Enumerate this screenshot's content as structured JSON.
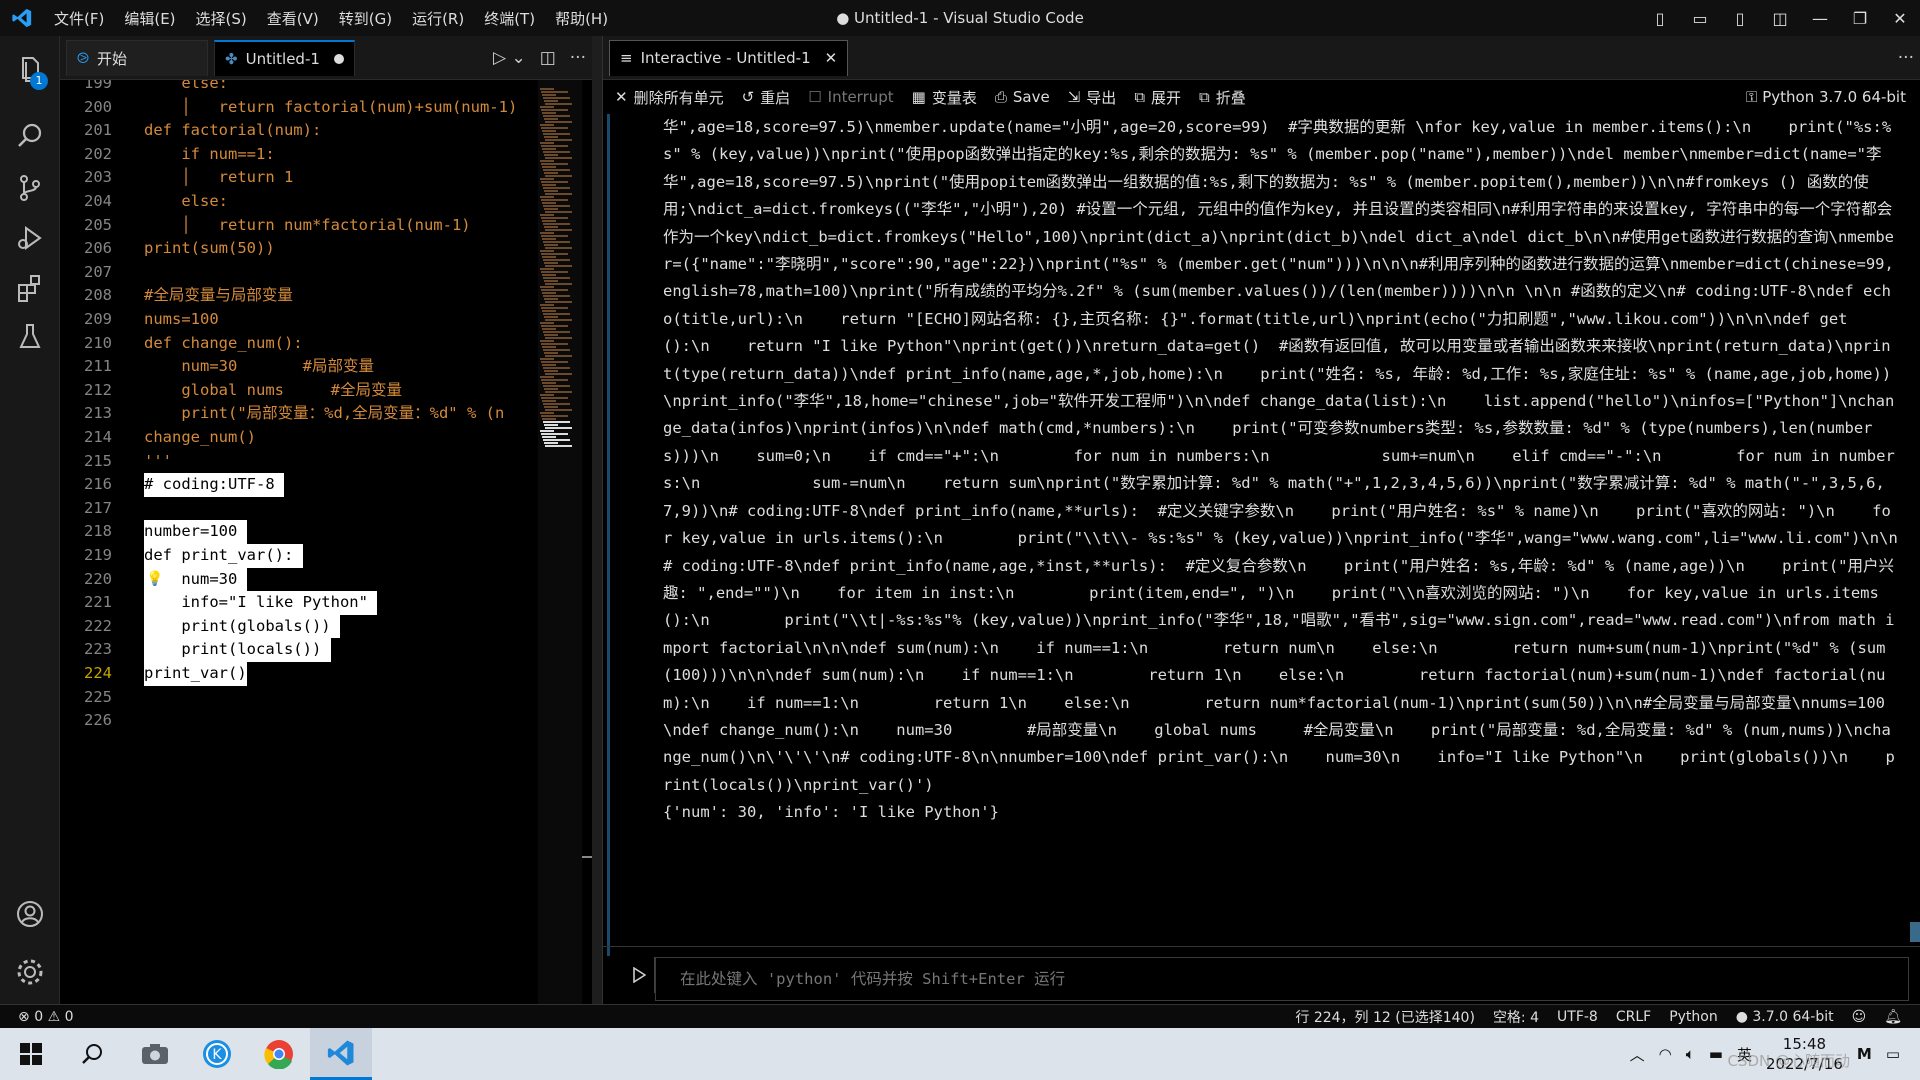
{
  "titlebar": {
    "title": "● Untitled-1 - Visual Studio Code",
    "menus": [
      "文件(F)",
      "编辑(E)",
      "选择(S)",
      "查看(V)",
      "转到(G)",
      "运行(R)",
      "终端(T)",
      "帮助(H)"
    ]
  },
  "activity": {
    "explorer_badge": "1"
  },
  "editor": {
    "tabs": [
      {
        "label": "开始",
        "active": false
      },
      {
        "label": "Untitled-1",
        "active": true,
        "dirty": true
      }
    ],
    "lines": [
      {
        "n": "199",
        "text": "    else:",
        "hl": false
      },
      {
        "n": "200",
        "text": "    │   return factorial(num)+sum(num-1)",
        "hl": false
      },
      {
        "n": "201",
        "text": "def factorial(num):",
        "hl": false
      },
      {
        "n": "202",
        "text": "    if num==1:",
        "hl": false
      },
      {
        "n": "203",
        "text": "    │   return 1",
        "hl": false
      },
      {
        "n": "204",
        "text": "    else:",
        "hl": false
      },
      {
        "n": "205",
        "text": "    │   return num*factorial(num-1)",
        "hl": false
      },
      {
        "n": "206",
        "text": "print(sum(50))",
        "hl": false
      },
      {
        "n": "207",
        "text": "",
        "hl": false
      },
      {
        "n": "208",
        "text": "#全局变量与局部变量",
        "hl": false
      },
      {
        "n": "209",
        "text": "nums=100",
        "hl": false
      },
      {
        "n": "210",
        "text": "def change_num():",
        "hl": false
      },
      {
        "n": "211",
        "text": "    num=30       #局部变量",
        "hl": false
      },
      {
        "n": "212",
        "text": "    global nums     #全局变量",
        "hl": false
      },
      {
        "n": "213",
        "text": "    print(\"局部变量：%d,全局变量：%d\" % (n",
        "hl": false
      },
      {
        "n": "214",
        "text": "change_num()",
        "hl": false
      },
      {
        "n": "215",
        "text": "'''",
        "hl": false
      },
      {
        "n": "216",
        "text": "# coding:UTF-8 ",
        "hl": true
      },
      {
        "n": "217",
        "text": "",
        "hl": false
      },
      {
        "n": "218",
        "text": "number=100 ",
        "hl": true
      },
      {
        "n": "219",
        "text": "def print_var(): ",
        "hl": true
      },
      {
        "n": "220",
        "text": "    num=30 ",
        "hl": true
      },
      {
        "n": "221",
        "text": "    info=\"I like Python\" ",
        "hl": true
      },
      {
        "n": "222",
        "text": "    print(globals()) ",
        "hl": true
      },
      {
        "n": "223",
        "text": "    print(locals()) ",
        "hl": true
      },
      {
        "n": "224",
        "text": "print_var()",
        "hl": true
      },
      {
        "n": "225",
        "text": "",
        "hl": false
      },
      {
        "n": "226",
        "text": "",
        "hl": false
      }
    ],
    "current_line": "224"
  },
  "interactive": {
    "tab_label": "Interactive - Untitled-1",
    "toolbar": {
      "clear_all": "删除所有单元",
      "restart": "重启",
      "interrupt": "Interrupt",
      "variables": "变量表",
      "save": "Save",
      "export": "导出",
      "expand": "展开",
      "collapse": "折叠"
    },
    "kernel": "Python 3.7.0 64-bit",
    "output_code": "华\",age=18,score=97.5)\\nmember.update(name=\"小明\",age=20,score=99)  #字典数据的更新 \\nfor key,value in member.items():\\n    print(\"%s:%s\" % (key,value))\\nprint(\"使用pop函数弹出指定的key:%s,剩余的数据为: %s\" % (member.pop(\"name\"),member))\\ndel member\\nmember=dict(name=\"李华\",age=18,score=97.5)\\nprint(\"使用popitem函数弹出一组数据的值:%s,剩下的数据为: %s\" % (member.popitem(),member))\\n\\n#fromkeys () 函数的使用;\\ndict_a=dict.fromkeys((\"李华\",\"小明\"),20) #设置一个元组, 元组中的值作为key, 并且设置的类容相同\\n#利用字符串的来设置key, 字符串中的每一个字符都会作为一个key\\ndict_b=dict.fromkeys(\"Hello\",100)\\nprint(dict_a)\\nprint(dict_b)\\ndel dict_a\\ndel dict_b\\n\\n#使用get函数进行数据的查询\\nmember=({\"name\":\"李晓明\",\"score\":90,\"age\":22})\\nprint(\"%s\" % (member.get(\"num\")))\\n\\n\\n#利用序列种的函数进行数据的运算\\nmember=dict(chinese=99,english=78,math=100)\\nprint(\"所有成绩的平均分%.2f\" % (sum(member.values())/(len(member))))\\n\\n \\n\\n #函数的定义\\n# coding:UTF-8\\ndef echo(title,url):\\n    return \"[ECHO]网站名称: {},主页名称: {}\".format(title,url)\\nprint(echo(\"力扣刷题\",\"www.likou.com\"))\\n\\n\\ndef get ():\\n    return \"I like Python\"\\nprint(get())\\nreturn_data=get()  #函数有返回值, 故可以用变量或者输出函数来来接收\\nprint(return_data)\\nprint(type(return_data))\\ndef print_info(name,age,*,job,home):\\n    print(\"姓名: %s, 年龄: %d,工作: %s,家庭住址: %s\" % (name,age,job,home))\\nprint_info(\"李华\",18,home=\"chinese\",job=\"软件开发工程师\")\\n\\ndef change_data(list):\\n    list.append(\"hello\")\\ninfos=[\"Python\"]\\nchange_data(infos)\\nprint(infos)\\n\\ndef math(cmd,*numbers):\\n    print(\"可变参数numbers类型: %s,参数数量: %d\" % (type(numbers),len(numbers)))\\n    sum=0;\\n    if cmd==\"+\":\\n        for num in numbers:\\n            sum+=num\\n    elif cmd==\"-\":\\n        for num in numbers:\\n            sum-=num\\n    return sum\\nprint(\"数字累加计算: %d\" % math(\"+\",1,2,3,4,5,6))\\nprint(\"数字累减计算: %d\" % math(\"-\",3,5,6,7,9))\\n# coding:UTF-8\\ndef print_info(name,**urls):  #定义关键字参数\\n    print(\"用户姓名: %s\" % name)\\n    print(\"喜欢的网站: \")\\n    for key,value in urls.items():\\n        print(\"\\\\t\\\\- %s:%s\" % (key,value))\\nprint_info(\"李华\",wang=\"www.wang.com\",li=\"www.li.com\")\\n\\n# coding:UTF-8\\ndef print_info(name,age,*inst,**urls):  #定义复合参数\\n    print(\"用户姓名: %s,年龄: %d\" % (name,age))\\n    print(\"用户兴趣: \",end=\"\")\\n    for item in inst:\\n        print(item,end=\", \")\\n    print(\"\\\\n喜欢浏览的网站: \")\\n    for key,value in urls.items():\\n        print(\"\\\\t|-%s:%s\"% (key,value))\\nprint_info(\"李华\",18,\"唱歌\",\"看书\",sig=\"www.sign.com\",read=\"www.read.com\")\\nfrom math import factorial\\n\\n\\ndef sum(num):\\n    if num==1:\\n        return num\\n    else:\\n        return num+sum(num-1)\\nprint(\"%d\" % (sum(100)))\\n\\n\\ndef sum(num):\\n    if num==1:\\n        return 1\\n    else:\\n        return factorial(num)+sum(num-1)\\ndef factorial(num):\\n    if num==1:\\n        return 1\\n    else:\\n        return num*factorial(num-1)\\nprint(sum(50))\\n\\n#全局变量与局部变量\\nnums=100\\ndef change_num():\\n    num=30        #局部变量\\n    global nums     #全局变量\\n    print(\"局部变量: %d,全局变量: %d\" % (num,nums))\\nchange_num()\\n\\'\\'\\'\\n# coding:UTF-8\\n\\nnumber=100\\ndef print_var():\\n    num=30\\n    info=\"I like Python\"\\n    print(globals())\\n    print(locals())\\nprint_var()')",
    "output_result": "{'num': 30, 'info': 'I like Python'}",
    "input_placeholder": "在此处键入 'python' 代码并按 Shift+Enter 运行"
  },
  "statusbar": {
    "errors": "0",
    "warnings": "0",
    "position": "行 224，列 12 (已选择140)",
    "spaces": "空格: 4",
    "encoding": "UTF-8",
    "eol": "CRLF",
    "language": "Python",
    "interpreter": "3.7.0 64-bit"
  },
  "taskbar": {
    "time": "15:48",
    "date": "2022/7/16",
    "ime": "英",
    "watermark": "CSDN @心随而动"
  }
}
